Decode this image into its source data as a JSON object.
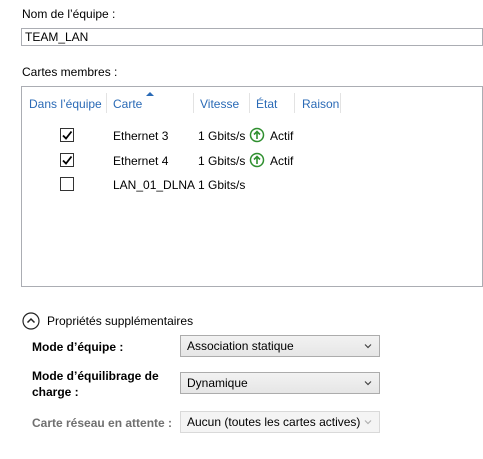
{
  "team_name": {
    "label": "Nom de l’équipe :",
    "value": "TEAM_LAN"
  },
  "members": {
    "label": "Cartes membres :",
    "columns": [
      "Dans l’équipe",
      "Carte",
      "Vitesse",
      "État",
      "Raison"
    ],
    "rows": [
      {
        "in_team": true,
        "adapter": "Ethernet 3",
        "speed": "1 Gbits/s",
        "status": "Actif",
        "status_icon": "up-arrow-circle-icon",
        "reason": ""
      },
      {
        "in_team": true,
        "adapter": "Ethernet 4",
        "speed": "1 Gbits/s",
        "status": "Actif",
        "status_icon": "up-arrow-circle-icon",
        "reason": ""
      },
      {
        "in_team": false,
        "adapter": "LAN_01_DLNA",
        "speed": "1 Gbits/s",
        "status": "",
        "status_icon": "",
        "reason": ""
      }
    ]
  },
  "additional_properties": {
    "toggle_label": "Propriétés supplémentaires",
    "teaming_mode": {
      "label": "Mode d’équipe :",
      "value": "Association statique"
    },
    "load_balancing": {
      "label_line1": "Mode d’équilibrage de",
      "label_line2": "charge :",
      "value": "Dynamique"
    },
    "standby": {
      "label": "Carte réseau en attente :",
      "value": "Aucun (toutes les cartes actives)",
      "disabled": true
    }
  },
  "colors": {
    "column_header": "#2a6ab6",
    "status_ok": "#2f8f2f",
    "disabled_text": "#707070"
  }
}
